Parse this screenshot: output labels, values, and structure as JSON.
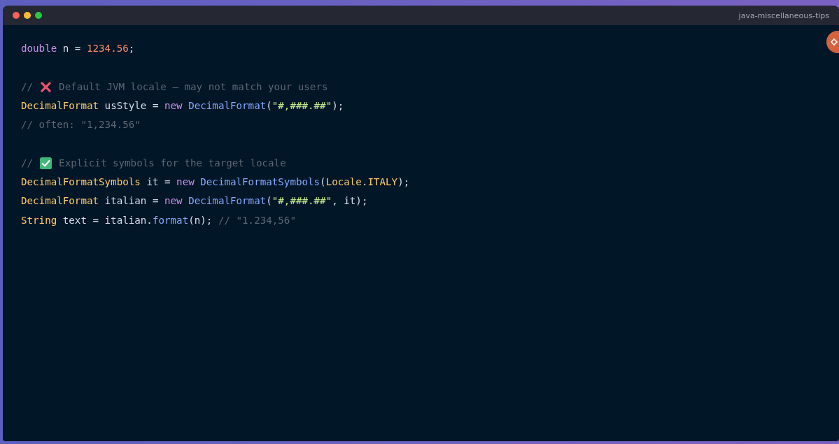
{
  "window": {
    "title": "java-miscellaneous-tips"
  },
  "code_lines": [
    {
      "kind": "code",
      "tokens": [
        {
          "kind": "keyword",
          "text": "double"
        },
        {
          "kind": "plain",
          "text": " n = "
        },
        {
          "kind": "number",
          "text": "1234.56"
        },
        {
          "kind": "plain",
          "text": ";"
        }
      ]
    },
    {
      "kind": "blank"
    },
    {
      "kind": "bad_comment",
      "prefix": "//",
      "text": "Default JVM locale — may not match your users"
    },
    {
      "kind": "code",
      "tokens": [
        {
          "kind": "type",
          "text": "DecimalFormat"
        },
        {
          "kind": "plain",
          "text": " usStyle = "
        },
        {
          "kind": "keyword",
          "text": "new"
        },
        {
          "kind": "function",
          "text": " DecimalFormat"
        },
        {
          "kind": "plain",
          "text": "("
        },
        {
          "kind": "string",
          "text": "\"#,###.##\""
        },
        {
          "kind": "plain",
          "text": ");"
        }
      ]
    },
    {
      "kind": "code",
      "tokens": [
        {
          "kind": "comment",
          "text": "// often: \"1,234.56\""
        }
      ]
    },
    {
      "kind": "blank"
    },
    {
      "kind": "good_comment",
      "prefix": "//",
      "text": "Explicit symbols for the target locale"
    },
    {
      "kind": "code",
      "tokens": [
        {
          "kind": "type",
          "text": "DecimalFormatSymbols"
        },
        {
          "kind": "plain",
          "text": " it = "
        },
        {
          "kind": "keyword",
          "text": "new"
        },
        {
          "kind": "function",
          "text": " DecimalFormatSymbols"
        },
        {
          "kind": "plain",
          "text": "("
        },
        {
          "kind": "type",
          "text": "Locale"
        },
        {
          "kind": "plain",
          "text": "."
        },
        {
          "kind": "type",
          "text": "ITALY"
        },
        {
          "kind": "plain",
          "text": ");"
        }
      ]
    },
    {
      "kind": "code",
      "tokens": [
        {
          "kind": "type",
          "text": "DecimalFormat"
        },
        {
          "kind": "plain",
          "text": " italian = "
        },
        {
          "kind": "keyword",
          "text": "new"
        },
        {
          "kind": "function",
          "text": " DecimalFormat"
        },
        {
          "kind": "plain",
          "text": "("
        },
        {
          "kind": "string",
          "text": "\"#,###.##\""
        },
        {
          "kind": "plain",
          "text": ", it);"
        }
      ]
    },
    {
      "kind": "code",
      "tokens": [
        {
          "kind": "type",
          "text": "String"
        },
        {
          "kind": "plain",
          "text": " text = italian."
        },
        {
          "kind": "function",
          "text": "format"
        },
        {
          "kind": "plain",
          "text": "(n); "
        },
        {
          "kind": "comment",
          "text": "// \"1.234,56\""
        }
      ]
    }
  ]
}
